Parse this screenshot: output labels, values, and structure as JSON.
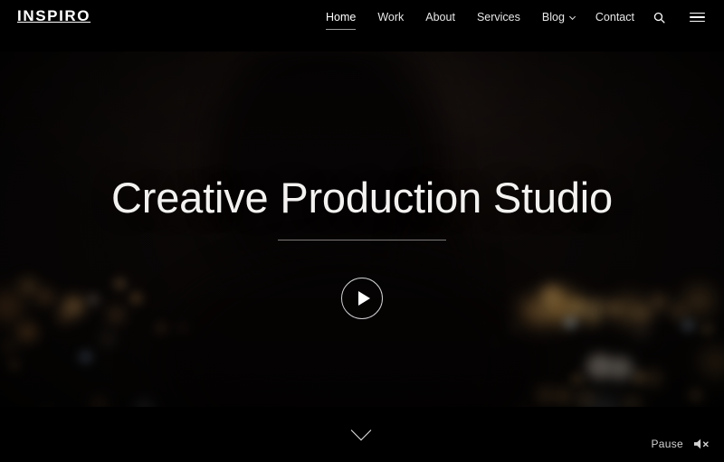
{
  "site": {
    "logo": "INSPIRO"
  },
  "nav": {
    "items": [
      {
        "label": "Home",
        "active": true,
        "has_dropdown": false
      },
      {
        "label": "Work",
        "active": false,
        "has_dropdown": false
      },
      {
        "label": "About",
        "active": false,
        "has_dropdown": false
      },
      {
        "label": "Services",
        "active": false,
        "has_dropdown": false
      },
      {
        "label": "Blog",
        "active": false,
        "has_dropdown": true
      },
      {
        "label": "Contact",
        "active": false,
        "has_dropdown": false
      }
    ],
    "search_icon": "search-icon",
    "menu_icon": "hamburger-menu-icon"
  },
  "hero": {
    "title": "Creative Production Studio",
    "divider": true,
    "play_icon": "play-icon"
  },
  "bottom_bar": {
    "scroll_icon": "chevron-down-icon",
    "pause_label": "Pause",
    "mute_icon": "speaker-muted-icon"
  },
  "colors": {
    "header_bg": "#000000",
    "text_primary": "#ffffff",
    "text_muted": "#d2d2d2",
    "hero_title": "#f4f2f1",
    "divider": "#ebe6e2"
  }
}
